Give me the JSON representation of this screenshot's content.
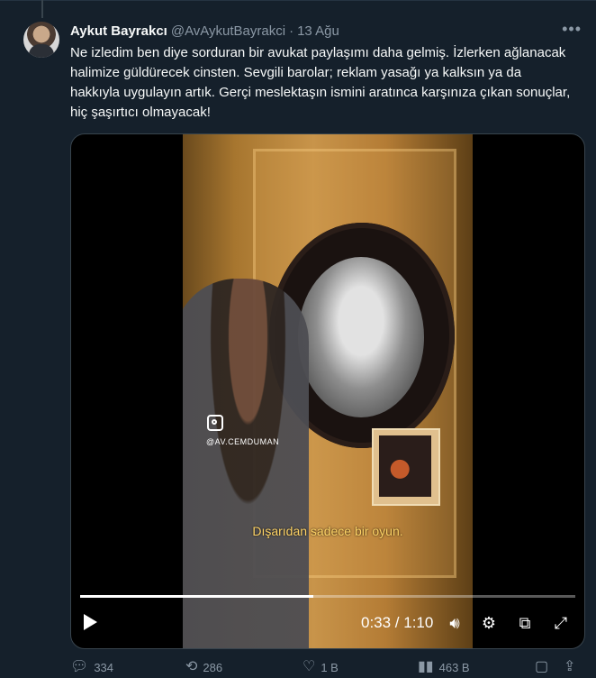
{
  "tweet": {
    "author_name": "Aykut Bayrakcı",
    "handle": "@AvAykutBayrakci",
    "separator": "·",
    "date": "13 Ağu",
    "more_icon": "more-horizontal-icon",
    "text": "Ne izledim ben diye sorduran bir avukat paylaşımı daha gelmiş. İzlerken ağlanacak halimize güldürecek cinsten. Sevgili barolar; reklam yasağı ya kalksın ya da hakkıyla uygulayın artık. Gerçi meslektaşın ismini aratınca karşınıza çıkan sonuçlar, hiç şaşırtıcı olmayacak!"
  },
  "video": {
    "watermark_handle": "@AV.CEMDUMAN",
    "subtitle": "Dışarıdan sadece bir oyun.",
    "time_display": "0:33 / 1:10",
    "progress": 0.47,
    "controls": [
      "play-icon",
      "volume-icon",
      "settings-icon",
      "pip-icon",
      "fullscreen-icon"
    ]
  },
  "actions": {
    "replies": "334",
    "retweets": "286",
    "likes": "1 B",
    "views": "463 B"
  },
  "colors": {
    "background": "#15202b",
    "text": "#f7f9f9",
    "muted": "#8b98a5",
    "subtitle": "#ffd466"
  }
}
